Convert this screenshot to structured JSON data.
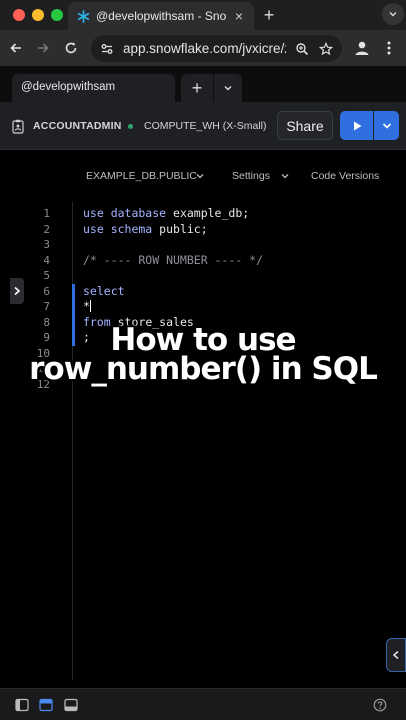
{
  "browser": {
    "tab_title": "@developwithsam - Snowflake",
    "url": "app.snowflake.com/jvxicre/z...",
    "new_tab_label": "+",
    "close_label": "×"
  },
  "worksheet": {
    "tab_label": "@developwithsam",
    "add_label": "+",
    "role": "ACCOUNTADMIN",
    "warehouse": "COMPUTE_WH (X-Small)",
    "share_label": "Share",
    "db_context": "EXAMPLE_DB.PUBLIC",
    "settings_label": "Settings",
    "versions_label": "Code Versions"
  },
  "editor": {
    "line_numbers": [
      "1",
      "2",
      "3",
      "4",
      "5",
      "6",
      "7",
      "8",
      "9",
      "10",
      "11",
      "12"
    ],
    "lines": {
      "l1_kw": "use database",
      "l1_rest": " example_db;",
      "l2_kw": "use schema",
      "l2_rest": " public;",
      "l4": "/* ---- ROW NUMBER ---- */",
      "l6": "select",
      "l7": "*",
      "l8_kw": "from",
      "l8_rest": " store_sales",
      "l9": ";"
    }
  },
  "caption": {
    "line1": "How to use",
    "line2": "row_number() in SQL"
  },
  "colors": {
    "accent": "#2f6fe0",
    "keyword": "#a6b4ff",
    "warehouse_status": "#2ea56b"
  }
}
